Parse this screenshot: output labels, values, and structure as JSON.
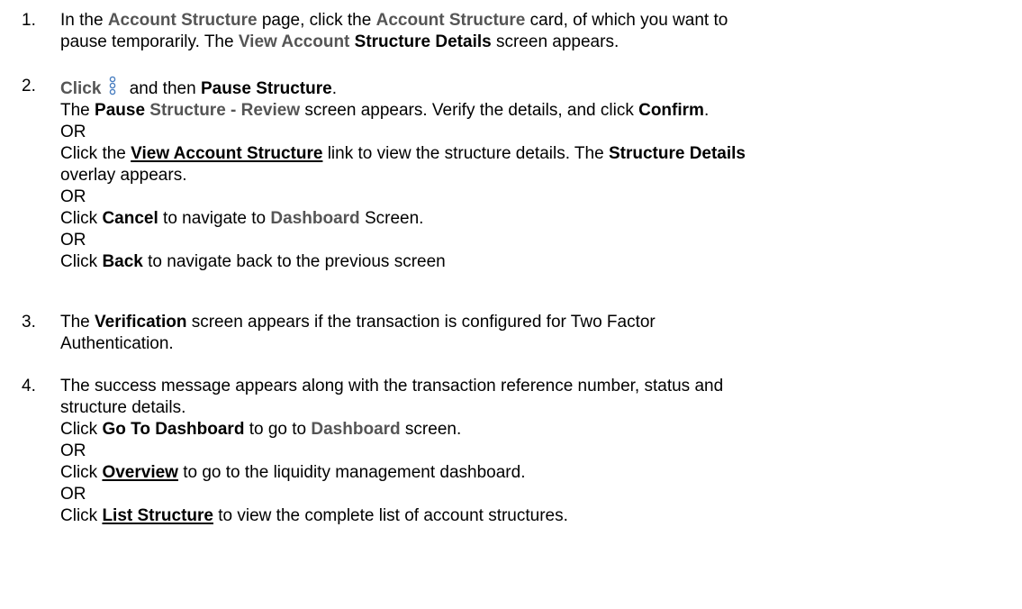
{
  "steps": [
    {
      "number": "1.",
      "lines": [
        [
          {
            "t": " In the "
          },
          {
            "t": "Account Structure",
            "s": "g"
          },
          {
            "t": " page, click the "
          },
          {
            "t": "Account Structure",
            "s": "g"
          },
          {
            "t": " card, of which you want to"
          }
        ],
        [
          {
            "t": "pause temporarily. The "
          },
          {
            "t": "View Account",
            "s": "g"
          },
          {
            "t": " "
          },
          {
            "t": "Structure Details",
            "s": "b"
          },
          {
            "t": " screen appears."
          }
        ]
      ]
    },
    {
      "number": "2.",
      "lines": [
        [
          {
            "t": "Click",
            "s": "g"
          },
          {
            "icon": "more-options-icon"
          },
          {
            "t": " and then "
          },
          {
            "t": "Pause Structure",
            "s": "b"
          },
          {
            "t": "."
          }
        ],
        [
          {
            "t": "The "
          },
          {
            "t": "Pause",
            "s": "b"
          },
          {
            "t": " "
          },
          {
            "t": "Structure - Review",
            "s": "g"
          },
          {
            "t": " screen appears. Verify the details, and click "
          },
          {
            "t": "Confirm",
            "s": "b"
          },
          {
            "t": "."
          }
        ],
        [
          {
            "t": "OR"
          }
        ],
        [
          {
            "t": "Click the "
          },
          {
            "t": "View Account Structure",
            "s": "u",
            "name": "view-account-structure-link"
          },
          {
            "t": " link to view the structure details. The "
          },
          {
            "t": "Structure Details",
            "s": "b"
          }
        ],
        [
          {
            "t": "overlay appears."
          }
        ],
        [
          {
            "t": "OR"
          }
        ],
        [
          {
            "t": "Click "
          },
          {
            "t": "Cancel",
            "s": "b"
          },
          {
            "t": " to navigate to "
          },
          {
            "t": "Dashboard",
            "s": "g"
          },
          {
            "t": " Screen."
          }
        ],
        [
          {
            "t": "OR"
          }
        ],
        [
          {
            "t": "Click "
          },
          {
            "t": "Back",
            "s": "b"
          },
          {
            "t": " to navigate back to the previous screen"
          }
        ]
      ]
    },
    {
      "number": "3.",
      "lines": [
        [
          {
            "t": "The "
          },
          {
            "t": "Verification",
            "s": "b"
          },
          {
            "t": " screen appears if the transaction is configured for Two Factor"
          }
        ],
        [
          {
            "t": "Authentication."
          }
        ]
      ]
    },
    {
      "number": "4.",
      "lines": [
        [
          {
            "t": "The success message appears along with the transaction reference number, status and"
          }
        ],
        [
          {
            "t": "structure details."
          }
        ],
        [
          {
            "t": "Click "
          },
          {
            "t": "Go To Dashboard",
            "s": "b"
          },
          {
            "t": " to go to "
          },
          {
            "t": "Dashboard",
            "s": "g"
          },
          {
            "t": " screen."
          }
        ],
        [
          {
            "t": "OR"
          }
        ],
        [
          {
            "t": "Click "
          },
          {
            "t": "Overview",
            "s": "u",
            "name": "overview-link"
          },
          {
            "t": " to go to the liquidity management dashboard."
          }
        ],
        [
          {
            "t": "OR"
          }
        ],
        [
          {
            "t": "Click "
          },
          {
            "t": "List Structure",
            "s": "u",
            "name": "list-structure-link"
          },
          {
            "t": " to view the complete list of account structures."
          }
        ]
      ]
    }
  ],
  "colors": {
    "text": "#000000",
    "muted_bold": "#555555",
    "icon": "#4a7fc1"
  }
}
